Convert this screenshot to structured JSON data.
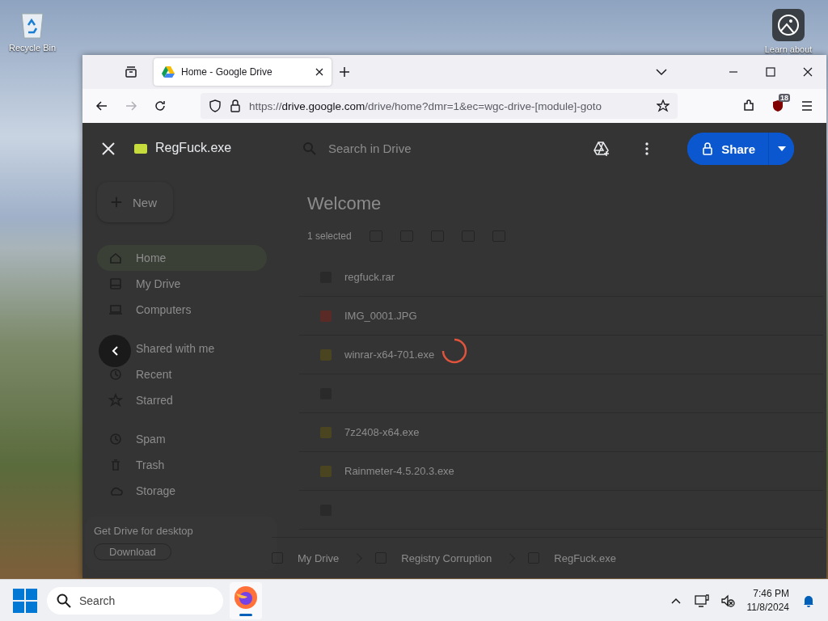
{
  "desktop": {
    "icons": [
      {
        "label": "Recycle Bin",
        "kind": "recycle"
      },
      {
        "label": "Learn about",
        "kind": "learn"
      }
    ]
  },
  "browser": {
    "tabs": [
      {
        "title": "Home - Google Drive",
        "selected": true
      }
    ],
    "url": "https://drive.google.com/drive/home?dmr=1&ec=wgc-drive-[module]-goto",
    "extension_badge": "18"
  },
  "drive": {
    "search_placeholder": "Search in Drive",
    "new_button": "New",
    "nav": [
      {
        "label": "Home",
        "selected": true,
        "kind": "home"
      },
      {
        "label": "My Drive",
        "selected": false,
        "kind": "drive"
      },
      {
        "label": "Computers",
        "selected": false,
        "kind": "computer"
      },
      {
        "label": "Shared with me",
        "selected": false,
        "kind": "people"
      },
      {
        "label": "Recent",
        "selected": false,
        "kind": "clock"
      },
      {
        "label": "Starred",
        "selected": false,
        "kind": "star"
      },
      {
        "label": "Spam",
        "selected": false,
        "kind": "clock"
      },
      {
        "label": "Trash",
        "selected": false,
        "kind": "trash"
      },
      {
        "label": "Storage",
        "selected": false,
        "kind": "cloud"
      }
    ],
    "promo": {
      "title": "Get Drive for desktop",
      "button": "Download"
    },
    "heading": "Welcome",
    "selection": "1 selected",
    "files": [
      {
        "name": "regfuck.rar",
        "kind": "file"
      },
      {
        "name": "IMG_0001.JPG",
        "kind": "image"
      },
      {
        "name": "winrar-x64-701.exe",
        "kind": "app"
      },
      {
        "kind": "archive"
      },
      {
        "name": "7z2408-x64.exe",
        "kind": "app"
      },
      {
        "name": "Rainmeter-4.5.20.3.exe",
        "kind": "app"
      },
      {
        "kind": "file"
      }
    ],
    "breadcrumb": [
      "My Drive",
      "Registry Corruption",
      "RegFuck.exe"
    ]
  },
  "preview": {
    "title": "RegFuck.exe",
    "share_label": "Share",
    "loading": true
  },
  "taskbar": {
    "search_placeholder": "Search",
    "time": "7:46 PM",
    "date": "11/8/2024"
  }
}
